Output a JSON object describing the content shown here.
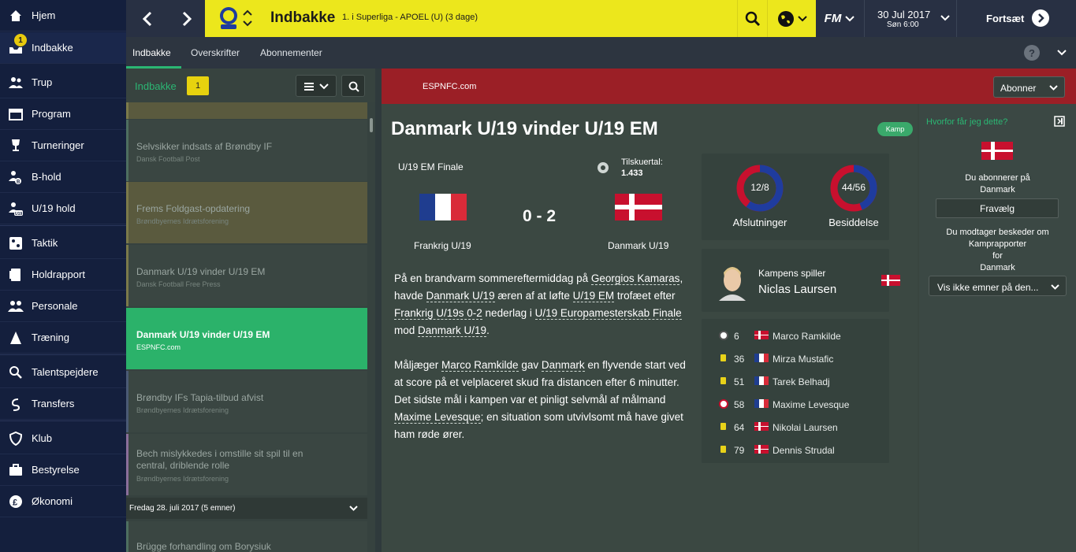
{
  "sidebar": {
    "items": [
      {
        "label": "Hjem",
        "icon": "home-icon"
      },
      {
        "label": "Indbakke",
        "icon": "inbox-icon",
        "badge": "1"
      },
      {
        "label": "Trup",
        "icon": "squad-icon"
      },
      {
        "label": "Program",
        "icon": "calendar-icon"
      },
      {
        "label": "Turneringer",
        "icon": "trophy-icon"
      },
      {
        "label": "B-hold",
        "icon": "b-team-icon"
      },
      {
        "label": "U/19 hold",
        "icon": "u19-team-icon"
      },
      {
        "label": "Taktik",
        "icon": "tactics-icon"
      },
      {
        "label": "Holdrapport",
        "icon": "report-icon"
      },
      {
        "label": "Personale",
        "icon": "staff-icon"
      },
      {
        "label": "Træning",
        "icon": "training-icon"
      },
      {
        "label": "Talentspejdere",
        "icon": "scouting-icon"
      },
      {
        "label": "Transfers",
        "icon": "transfers-icon"
      },
      {
        "label": "Klub",
        "icon": "club-icon"
      },
      {
        "label": "Bestyrelse",
        "icon": "board-icon"
      },
      {
        "label": "Økonomi",
        "icon": "finance-icon"
      }
    ]
  },
  "header": {
    "title": "Indbakke",
    "subtitle": "1. i Superliga - APOEL (U) (3 dage)",
    "fm_label": "FM",
    "date": "30 Jul 2017",
    "day_time": "Søn 6:00",
    "continue_label": "Fortsæt"
  },
  "tabs": [
    "Indbakke",
    "Overskrifter",
    "Abonnementer"
  ],
  "inbox": {
    "label": "Indbakke",
    "count": "1",
    "items": [
      {
        "title": "Selvsikker indsats af Brøndby IF",
        "source": "Dansk Football Post",
        "style": "normal"
      },
      {
        "title": "Frems Foldgast-opdatering",
        "source": "Brøndbyernes Idrætsforening",
        "style": "olive"
      },
      {
        "title": "Danmark U/19 vinder U/19 EM",
        "source": "Dansk Football Free Press",
        "style": "normal"
      },
      {
        "title": "Danmark U/19 vinder U/19 EM",
        "source": "ESPNFC.com",
        "style": "selected"
      },
      {
        "title": "Brøndby IFs Tapia-tilbud afvist",
        "source": "Brøndbyernes Idrætsforening",
        "style": "normal"
      },
      {
        "title": "Bech mislykkedes i omstille sit spil til en central, driblende rolle",
        "source": "Brøndbyernes Idrætsforening",
        "style": "purple"
      }
    ],
    "group_label": "Fredag 28. juli 2017 (5 emner)",
    "next_item": "Brügge forhandling om Borysiuk"
  },
  "article": {
    "source": "ESPNFC.com",
    "subscribe_label": "Abonner",
    "title": "Danmark U/19 vinder U/19 EM",
    "tag": "Kamp",
    "competition": "U/19 EM Finale",
    "attendance_label": "Tilskuertal:",
    "attendance": "1.433",
    "home_team": "Frankrig U/19",
    "away_team": "Danmark U/19",
    "score": "0 - 2",
    "p1": {
      "t0": "På en brandvarm sommereftermiddag på ",
      "l0": "Georgios Kamaras",
      "t1": ", havde ",
      "l1": "Danmark U/19",
      "t2": " æren af at løfte ",
      "l2": "U/19 EM",
      "t3": " trofæet efter ",
      "l3": "Frankrig U/19s 0-2",
      "t4": " nederlag i ",
      "l4": "U/19 Europamesterskab Finale",
      "t5": " mod ",
      "l5": "Danmark U/19",
      "t6": "."
    },
    "p2": {
      "t0": "Måljæger ",
      "l0": "Marco Ramkilde",
      "t1": " gav ",
      "l1": "Danmark",
      "t2": " en flyvende start ved at score på et velplaceret skud fra distancen efter 6 minutter. Det sidste mål i kampen var et pinligt selvmål af målmand ",
      "l2": "Maxime Levesque",
      "t3": "; en situation som utvivlsomt må have givet ham røde ører."
    }
  },
  "stats": {
    "shots_value": "12/8",
    "shots_label": "Afslutninger",
    "shots_fraction": 0.6,
    "possession_value": "44/56",
    "possession_label": "Besiddelse",
    "possession_fraction": 0.44,
    "colors": {
      "home": "#1f3c9e",
      "away": "#c8102e"
    }
  },
  "motm": {
    "label": "Kampens spiller",
    "name": "Niclas Laursen"
  },
  "events": [
    {
      "icon": "goal-icon",
      "minute": "6",
      "flag": "dk",
      "player": "Marco Ramkilde"
    },
    {
      "icon": "yellow-card-icon",
      "minute": "36",
      "flag": "fr",
      "player": "Mirza Mustafic"
    },
    {
      "icon": "yellow-card-icon",
      "minute": "51",
      "flag": "fr",
      "player": "Tarek Belhadj"
    },
    {
      "icon": "own-goal-icon",
      "minute": "58",
      "flag": "fr",
      "player": "Maxime Levesque"
    },
    {
      "icon": "yellow-card-icon",
      "minute": "64",
      "flag": "dk",
      "player": "Nikolai Laursen"
    },
    {
      "icon": "yellow-card-icon",
      "minute": "79",
      "flag": "dk",
      "player": "Dennis Strudal"
    }
  ],
  "right_panel": {
    "why_label": "Hvorfor får jeg dette?",
    "subscribe_text_1": "Du abonnerer på",
    "subscribe_text_2": "Danmark",
    "unsubscribe_label": "Fravælg",
    "receive_1": "Du modtager beskeder om",
    "receive_2": "Kamprapporter",
    "receive_3": "for",
    "receive_4": "Danmark",
    "dropdown_label": "Vis ikke emner på den..."
  },
  "colors": {
    "accent_green": "#2bb673",
    "header_yellow": "#ece71c",
    "news_red": "#9b1f26",
    "sidebar_bg": "#141f3d"
  }
}
